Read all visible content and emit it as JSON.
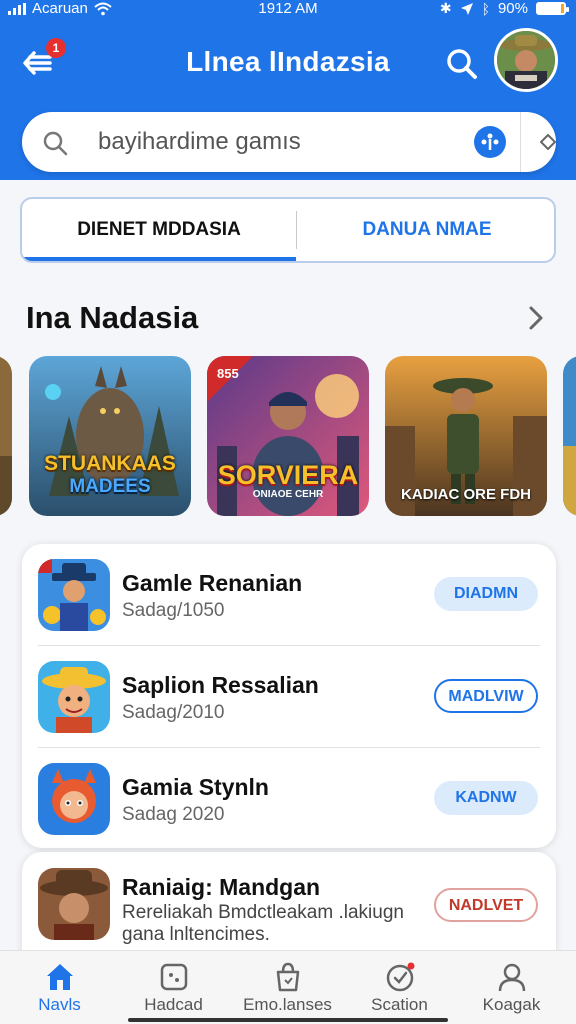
{
  "status_bar": {
    "carrier": "Acaruan",
    "time": "1912 AM",
    "battery": "90%"
  },
  "header": {
    "title": "Llnea lIndazsia",
    "notification_count": "1"
  },
  "search": {
    "query": "bayihardime gamıs"
  },
  "tabs": [
    {
      "label": "DIENET MDDASIA",
      "active": true
    },
    {
      "label": "DANUA NMAE",
      "active": false
    }
  ],
  "featured": {
    "title": "Ina Nadasia",
    "cards": [
      {
        "title_line1": "STUANKAAS",
        "title_line2": "MADEES"
      },
      {
        "badge": "855",
        "title": "SORVIERA",
        "subtitle": "ONIAOE CEHR"
      },
      {
        "title": "KADIAC ORE FDH"
      }
    ]
  },
  "apps": [
    {
      "name": "Gamle Renanian",
      "sub": "Sadag/1050",
      "action": "DIADMN",
      "style": "filled"
    },
    {
      "name": "Saplion Ressalian",
      "sub": "Sadag/2010",
      "action": "MADLVIW",
      "style": "outline"
    },
    {
      "name": "Gamia Stynln",
      "sub": "Sadag 2020",
      "action": "KADNW",
      "style": "filled"
    },
    {
      "name": "Raniaig: Mandgan",
      "sub": "Rereliakah Bmdctleakam .lakiugn gana lnltencimes.",
      "action": "NADLVET",
      "style": "red"
    }
  ],
  "bottom_nav": [
    {
      "label": "Navls",
      "icon": "home-icon",
      "active": true
    },
    {
      "label": "Hadcad",
      "icon": "dice-icon",
      "active": false
    },
    {
      "label": "Emo.lanses",
      "icon": "bag-icon",
      "active": false
    },
    {
      "label": "Scation",
      "icon": "clock-icon",
      "active": false
    },
    {
      "label": "Koagak",
      "icon": "person-icon",
      "active": false
    }
  ],
  "colors": {
    "primary": "#1f74e8",
    "badge_red": "#e5302f",
    "pill_bg": "#dcebfb",
    "battery_fill": "#f5a623"
  }
}
